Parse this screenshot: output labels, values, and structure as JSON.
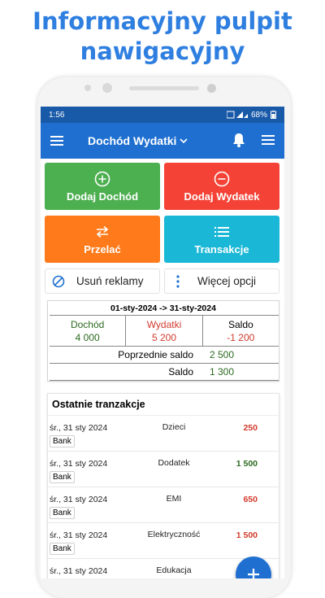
{
  "headline": {
    "line1": "Informacyjny pulpit",
    "line2": "nawigacyjny"
  },
  "status": {
    "time": "1:56",
    "battery": "68%"
  },
  "appbar": {
    "title": "Dochód Wydatki"
  },
  "tiles": {
    "add_income": "Dodaj Dochód",
    "add_expense": "Dodaj Wydatek",
    "transfer": "Przelać",
    "transactions": "Transakcje"
  },
  "options": {
    "remove_ads": "Usuń reklamy",
    "more_options": "Więcej opcji"
  },
  "summary": {
    "period": "01-sty-2024 -> 31-sty-2024",
    "income_label": "Dochód",
    "income_value": "4 000",
    "expense_label": "Wydatki",
    "expense_value": "5 200",
    "balance_label": "Saldo",
    "balance_value": "-1 200",
    "prev_balance_label": "Poprzednie saldo",
    "prev_balance_value": "2 500",
    "total_balance_label": "Saldo",
    "total_balance_value": "1 300"
  },
  "recent": {
    "title": "Ostatnie tranzakcje",
    "rows": [
      {
        "date": "śr., 31 sty 2024",
        "category": "Dzieci",
        "amount": "250",
        "account": "Bank",
        "type": "expense"
      },
      {
        "date": "śr., 31 sty 2024",
        "category": "Dodatek",
        "amount": "1 500",
        "account": "Bank",
        "type": "income"
      },
      {
        "date": "śr., 31 sty 2024",
        "category": "EMI",
        "amount": "650",
        "account": "Bank",
        "type": "expense"
      },
      {
        "date": "śr., 31 sty 2024",
        "category": "Elektryczność",
        "amount": "1 500",
        "account": "Bank",
        "type": "expense"
      },
      {
        "date": "śr., 31 sty 2024",
        "category": "Edukacja",
        "amount": "",
        "account": "",
        "type": "expense"
      }
    ]
  },
  "colors": {
    "primary": "#1e6fd0",
    "income_tile": "#4caf50",
    "expense_tile": "#f44336",
    "transfer_tile": "#ff7a1a",
    "transactions_tile": "#1ab8d6",
    "income_text": "#2b6a1f",
    "expense_text": "#d23b2e"
  },
  "icons": {
    "menu": "hamburger-icon",
    "bell": "bell-icon",
    "plus_circle": "plus-circle-icon",
    "minus_circle": "minus-circle-icon",
    "transfer": "swap-arrows-icon",
    "list": "list-icon",
    "block": "block-icon",
    "more": "more-vert-icon",
    "fab": "add-icon"
  }
}
